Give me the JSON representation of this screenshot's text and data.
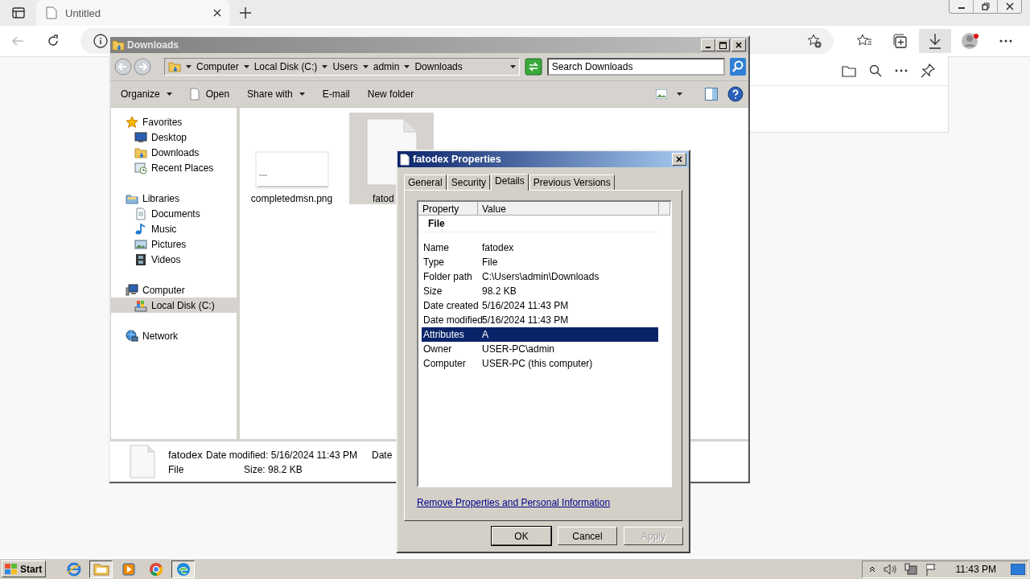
{
  "browser": {
    "tabs": [
      {
        "title": "Untitled",
        "selected": true
      }
    ],
    "downloads_open": true
  },
  "explorer": {
    "title": "Downloads",
    "breadcrumb": [
      "Computer",
      "Local Disk (C:)",
      "Users",
      "admin",
      "Downloads"
    ],
    "search": {
      "placeholder": "Search Downloads"
    },
    "toolbar": [
      {
        "label": "Organize",
        "kind": "menu"
      },
      {
        "label": "Open",
        "kind": "icon"
      },
      {
        "label": "Share with",
        "kind": "menu"
      },
      {
        "label": "E-mail",
        "kind": "plain"
      },
      {
        "label": "New folder",
        "kind": "plain"
      }
    ],
    "nav": [
      {
        "label": "Favorites",
        "selected": false,
        "children": [
          {
            "label": "Desktop",
            "selected": false
          },
          {
            "label": "Downloads",
            "selected": false
          },
          {
            "label": "Recent Places",
            "selected": false
          }
        ]
      },
      {
        "label": "Libraries",
        "selected": false,
        "children": [
          {
            "label": "Documents",
            "selected": false
          },
          {
            "label": "Music",
            "selected": false
          },
          {
            "label": "Pictures",
            "selected": false
          },
          {
            "label": "Videos",
            "selected": false
          }
        ]
      },
      {
        "label": "Computer",
        "selected": false,
        "children": [
          {
            "label": "Local Disk (C:)",
            "selected": true
          }
        ]
      },
      {
        "label": "Network",
        "selected": false
      }
    ],
    "files": [
      {
        "name": "completedmsn.png",
        "kind": "image",
        "selected": false
      },
      {
        "name": "fatod",
        "kind": "document",
        "selected": true
      }
    ],
    "details": {
      "name": "fatodex",
      "type": "File",
      "modified": "Date modified: 5/16/2024 11:43 PM",
      "size": "Size: 98.2 KB",
      "column_3": "Date"
    }
  },
  "properties": {
    "title": "fatodex Properties",
    "tabs": [
      {
        "label": "General",
        "selected": false
      },
      {
        "label": "Security",
        "selected": false
      },
      {
        "label": "Details",
        "selected": true
      },
      {
        "label": "Previous Versions",
        "selected": false
      }
    ],
    "columns": [
      "Property",
      "Value"
    ],
    "group": "File",
    "rows": [
      {
        "property": "Name",
        "value": "fatodex",
        "selected": false
      },
      {
        "property": "Type",
        "value": "File",
        "selected": false
      },
      {
        "property": "Folder path",
        "value": "C:\\Users\\admin\\Downloads",
        "selected": false
      },
      {
        "property": "Size",
        "value": "98.2 KB",
        "selected": false
      },
      {
        "property": "Date created",
        "value": "5/16/2024 11:43 PM",
        "selected": false
      },
      {
        "property": "Date modified",
        "value": "5/16/2024 11:43 PM",
        "selected": false
      },
      {
        "property": "Attributes",
        "value": "A",
        "selected": true
      },
      {
        "property": "Owner",
        "value": "USER-PC\\admin",
        "selected": false
      },
      {
        "property": "Computer",
        "value": "USER-PC (this computer)",
        "selected": false
      }
    ],
    "link": "Remove Properties and Personal Information",
    "buttons": [
      {
        "label": "OK",
        "default": true,
        "disabled": false
      },
      {
        "label": "Cancel",
        "default": false,
        "disabled": false
      },
      {
        "label": "Apply",
        "default": false,
        "disabled": true
      }
    ]
  },
  "taskbar": {
    "start": "Start",
    "apps": [
      {
        "kind": "ie",
        "active": false
      },
      {
        "kind": "explorer",
        "active": true
      },
      {
        "kind": "media",
        "active": false
      },
      {
        "kind": "chrome",
        "active": false
      },
      {
        "kind": "edge",
        "active": true
      }
    ],
    "clock": "11:43 PM"
  }
}
